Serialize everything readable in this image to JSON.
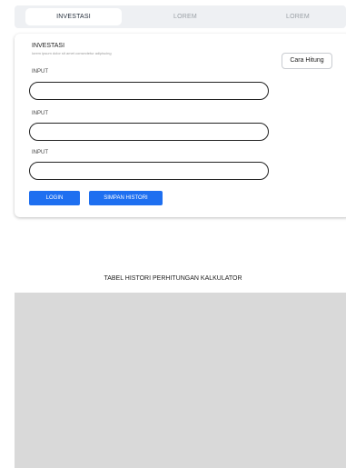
{
  "tabs": [
    {
      "label": "INVESTASI",
      "active": true
    },
    {
      "label": "LOREM",
      "active": false
    },
    {
      "label": "LOREM",
      "active": false
    }
  ],
  "card": {
    "title": "INVESTASI",
    "subtitle": "lorem ipsum dolor sit amet consectetur adipiscing",
    "cara_hitung_label": "Cara Hitung",
    "fields": [
      {
        "label": "INPUT",
        "value": ""
      },
      {
        "label": "INPUT",
        "value": ""
      },
      {
        "label": "INPUT",
        "value": ""
      }
    ],
    "login_label": "LOGIN",
    "simpan_label": "SIMPAN HISTORI"
  },
  "table": {
    "title": "TABEL HISTORI PERHITUNGAN KALKULATOR"
  },
  "colors": {
    "accent": "#1e6ff0",
    "tab_bg": "#eef0f3",
    "table_bg": "#d9d9d9"
  }
}
